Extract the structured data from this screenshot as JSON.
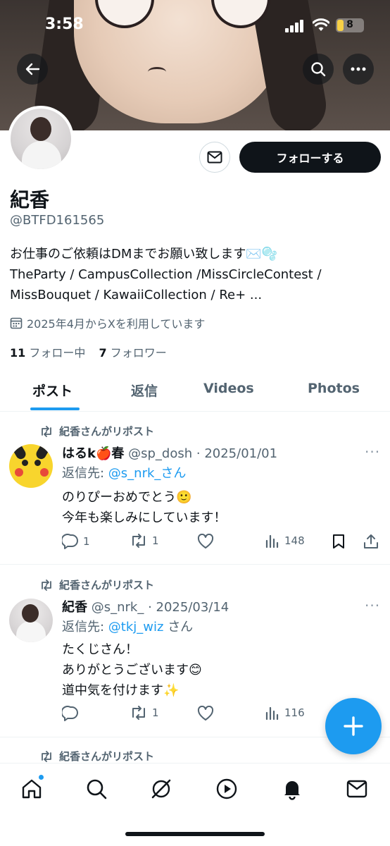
{
  "status_bar": {
    "time": "3:58",
    "battery": "8"
  },
  "profile": {
    "name": "紀香",
    "handle": "@BTFD161565",
    "bio_line1": "お仕事のご依頼はDMまでお願い致します✉️🫧",
    "bio_line2": "TheParty / CampusCollection /MissCircleContest /",
    "bio_line3": "MissBouquet / KawaiiCollection / Re+ ...",
    "joined": "2025年4月からXを利用しています",
    "following_count": "11",
    "following_label": "フォロー中",
    "followers_count": "7",
    "followers_label": "フォロワー",
    "follow_button": "フォローする"
  },
  "tabs": [
    {
      "label": "ポスト",
      "active": true
    },
    {
      "label": "返信",
      "active": false
    },
    {
      "label": "Videos",
      "active": false
    },
    {
      "label": "Photos",
      "active": false
    }
  ],
  "posts": [
    {
      "repost_label": "紀香さんがリポスト",
      "author": "はるk🍎春",
      "meta": "@sp_dosh · 2025/01/01",
      "reply_prefix": "返信先: ",
      "reply_to": "@s_nrk_さん",
      "text_line1": "のりぴーおめでとう🙂",
      "text_line2": "今年も楽しみにしています！",
      "replies": "1",
      "reposts": "1",
      "likes": "",
      "views": "148"
    },
    {
      "repost_label": "紀香さんがリポスト",
      "author": "紀香",
      "meta": "@s_nrk_ · 2025/03/14",
      "reply_prefix": "返信先: ",
      "reply_to": "@tkj_wiz",
      "reply_suffix": "さん",
      "text_line1": "たくじさん！",
      "text_line2": "ありがとうございます😊",
      "text_line3": "道中気を付けます✨",
      "replies": "",
      "reposts": "1",
      "likes": "",
      "views": "116"
    },
    {
      "repost_label": "紀香さんがリポスト"
    }
  ],
  "colors": {
    "accent": "#1d9bf0",
    "text": "#0f1419",
    "muted": "#536471"
  }
}
